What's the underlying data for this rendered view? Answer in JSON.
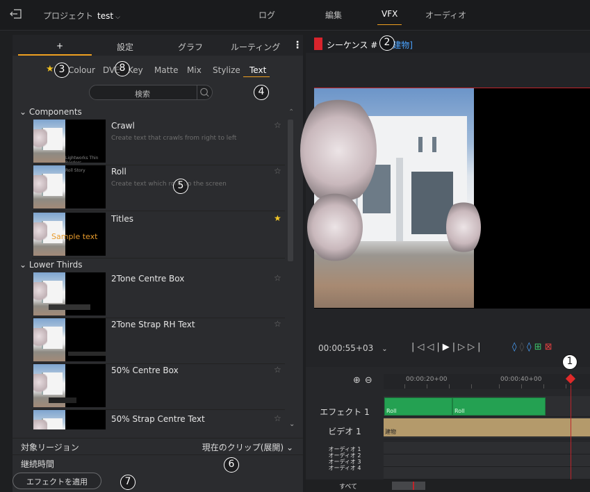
{
  "topbar": {
    "project_label": "プロジェクト",
    "project_name": "test",
    "tabs": [
      "ログ",
      "編集",
      "VFX",
      "オーディオ"
    ]
  },
  "left_tabs": [
    "+",
    "設定",
    "グラフ",
    "ルーティング"
  ],
  "subtabs": [
    "Colour",
    "DVE",
    "Key",
    "Matte",
    "Mix",
    "Stylize",
    "Text"
  ],
  "search": {
    "placeholder": "検索"
  },
  "sections": {
    "components": "Components",
    "lower_thirds": "Lower Thirds"
  },
  "items": [
    {
      "name": "Crawl",
      "desc": "Create text that crawls from right to left",
      "thumb_text": "Lightworks   Thin Borders",
      "favorite": false
    },
    {
      "name": "Roll",
      "desc": "Create text which rolls up the screen",
      "thumb_text": "Roll Story",
      "favorite": false
    },
    {
      "name": "Titles",
      "desc": "",
      "thumb_text": "Sample text",
      "favorite": true
    },
    {
      "name": "2Tone Centre Box",
      "desc": "",
      "thumb_text": "",
      "favorite": false
    },
    {
      "name": "2Tone Strap RH Text",
      "desc": "",
      "thumb_text": "",
      "favorite": false
    },
    {
      "name": "50% Centre Box",
      "desc": "",
      "thumb_text": "",
      "favorite": false
    },
    {
      "name": "50% Strap Centre Text",
      "desc": "",
      "thumb_text": "",
      "favorite": false
    }
  ],
  "props": {
    "region_label": "対象リージョン",
    "region_value": "現在のクリップ(展開)",
    "duration_label": "継続時間"
  },
  "apply_button": "エフェクトを適用",
  "sequence": {
    "title": "シーケンス #",
    "tag": "建物]"
  },
  "timecode": "00:00:55+03",
  "ruler": [
    "00:00:20+00",
    "00:00:40+00"
  ],
  "tracks": {
    "effect": "エフェクト 1",
    "video": "ビデオ 1",
    "audio": [
      "オーディオ 1",
      "オーディオ 2",
      "オーディオ 3",
      "オーディオ 4"
    ],
    "all": "すべて"
  },
  "clips": {
    "roll1": "Roll",
    "roll2": "Roll",
    "video": "建物"
  },
  "callouts": [
    "1",
    "2",
    "3",
    "4",
    "5",
    "6",
    "7",
    "8"
  ],
  "colors": {
    "accent": "#f0a020",
    "favorite": "#f4c826",
    "green_clip": "#24a152",
    "video_clip": "#b49a6b",
    "playhead": "#c0242a",
    "tag_blue": "#4aa3ff"
  }
}
